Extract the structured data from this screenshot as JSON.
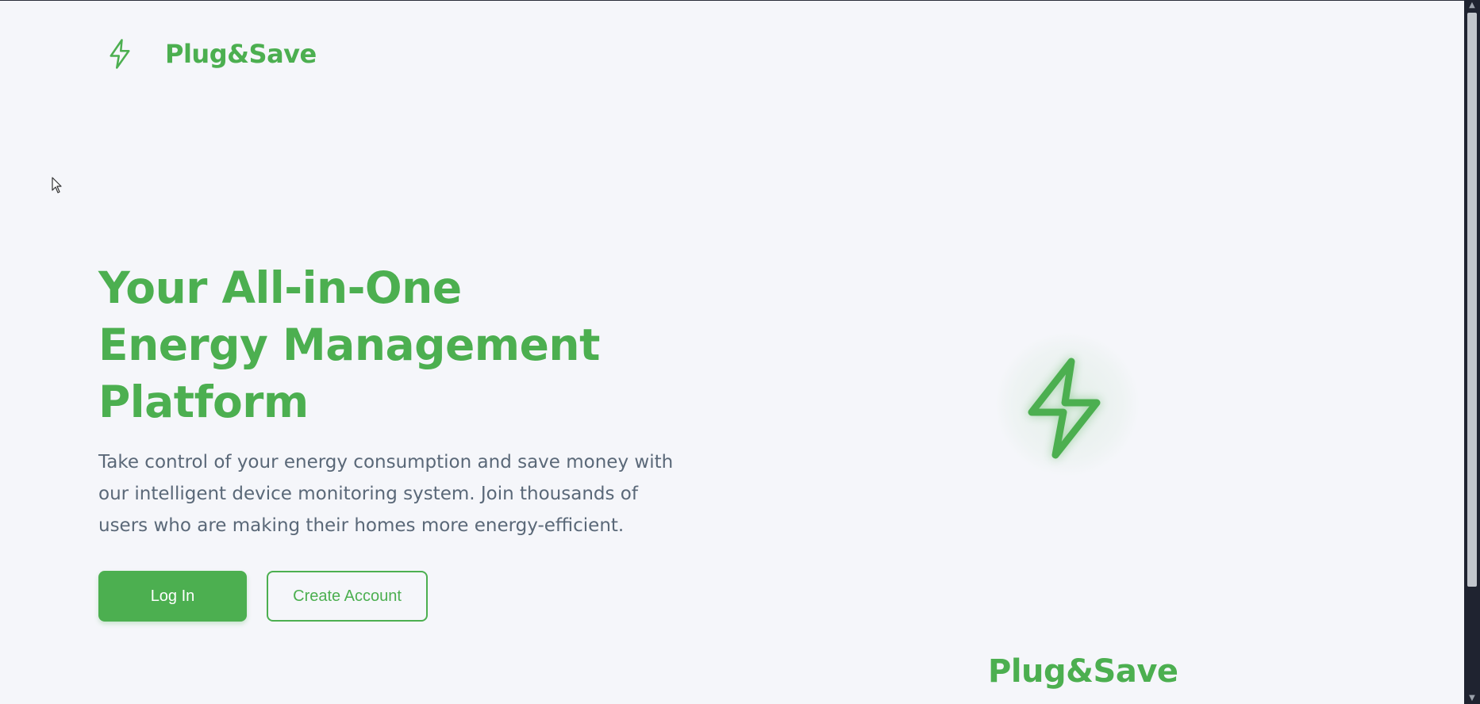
{
  "header": {
    "brand_name": "Plug&Save",
    "logo_icon": "lightning-bolt-icon"
  },
  "hero": {
    "title_lines": [
      "Your All-in-One",
      "Energy Management",
      "Platform"
    ],
    "description_lines": [
      "Take control of your energy consumption and save money with",
      "our intelligent device monitoring system. Join thousands of",
      "users who are making their homes more energy-efficient."
    ],
    "login_label": "Log In",
    "create_account_label": "Create Account"
  },
  "illustration": {
    "icon": "lightning-bolt-icon",
    "brand_name": "Plug&Save"
  },
  "colors": {
    "accent": "#4caf50",
    "background": "#f5f6fa",
    "body_text": "#5a6878"
  }
}
